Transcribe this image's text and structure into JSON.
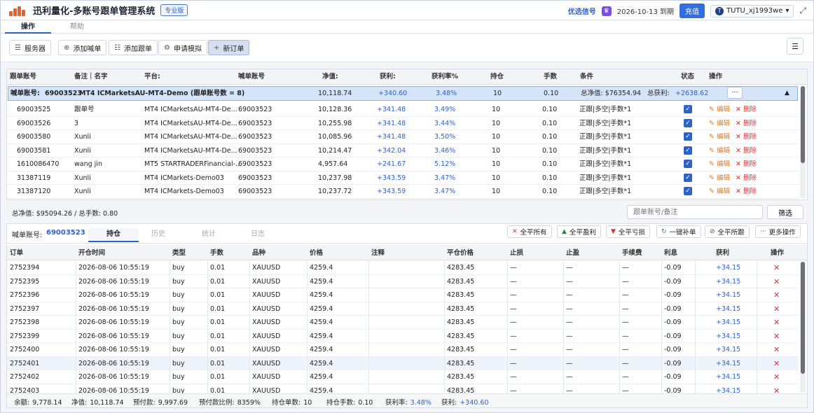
{
  "app": {
    "title": "迅利量化-多账号跟单管理系统",
    "edition": "专业版",
    "signal_link": "优选信号",
    "expire": "2026-10-13 到期",
    "recharge": "充值",
    "user": "TUTU_xj1993we",
    "user_initial": "T"
  },
  "top_tabs": [
    "操作",
    "帮助"
  ],
  "toolbar": {
    "server": "服务器",
    "add_signal": "添加喊单",
    "add_follow": "添加跟单",
    "apply_demo": "申请模拟",
    "new_order": "新订单"
  },
  "upper_table": {
    "headers": [
      "跟单账号",
      "备注｜名字",
      "平台:",
      "喊单账号",
      "净值:",
      "获利:",
      "获利率%",
      "持仓",
      "手数",
      "条件",
      "状态",
      "操作"
    ],
    "group": {
      "label": "喊单账号:",
      "account": "69003523",
      "platform": "MT4 ICMarketsAU-MT4-Demo (跟单账号数 = 8)",
      "equity": "10,118.74",
      "profit": "+340.60",
      "rate": "3.48%",
      "positions": "10",
      "lots": "0.10",
      "total_equity": "总净值:  $76354.94",
      "total_profit_label": "总获利:",
      "total_profit": "+2638.62",
      "more": "···",
      "sort": "▲"
    },
    "rows": [
      {
        "acct": "69003525",
        "note": "跟单号",
        "platform": "MT4 ICMarketsAU-MT4-De...",
        "signal": "69003523",
        "equity": "10,128.36",
        "profit": "+341.48",
        "rate": "3.49%",
        "pos": "10",
        "lots": "0.10",
        "cond": "正跟|多空|手数*1"
      },
      {
        "acct": "69003526",
        "note": "3",
        "platform": "MT4 ICMarketsAU-MT4-De...",
        "signal": "69003523",
        "equity": "10,255.98",
        "profit": "+341.48",
        "rate": "3.44%",
        "pos": "10",
        "lots": "0.10",
        "cond": "正跟|多空|手数*1"
      },
      {
        "acct": "69003580",
        "note": "Xunli",
        "platform": "MT4 ICMarketsAU-MT4-De...",
        "signal": "69003523",
        "equity": "10,085.96",
        "profit": "+341.48",
        "rate": "3.50%",
        "pos": "10",
        "lots": "0.10",
        "cond": "正跟|多空|手数*1"
      },
      {
        "acct": "69003581",
        "note": "Xunli",
        "platform": "MT4 ICMarketsAU-MT4-De...",
        "signal": "69003523",
        "equity": "10,214.47",
        "profit": "+342.04",
        "rate": "3.46%",
        "pos": "10",
        "lots": "0.10",
        "cond": "正跟|多空|手数*1"
      },
      {
        "acct": "1610086470",
        "note": "wang jin",
        "platform": "MT5 STARTRADERFinancial-...",
        "signal": "69003523",
        "equity": "4,957.64",
        "profit": "+241.67",
        "rate": "5.12%",
        "pos": "10",
        "lots": "0.10",
        "cond": "正跟|多空|手数*1"
      },
      {
        "acct": "31387119",
        "note": "Xunli",
        "platform": "MT4 ICMarkets-Demo03",
        "signal": "69003523",
        "equity": "10,237.98",
        "profit": "+343.59",
        "rate": "3.47%",
        "pos": "10",
        "lots": "0.10",
        "cond": "正跟|多空|手数*1"
      },
      {
        "acct": "31387120",
        "note": "Xunli",
        "platform": "MT4 ICMarkets-Demo03",
        "signal": "69003523",
        "equity": "10,237.72",
        "profit": "+343.59",
        "rate": "3.47%",
        "pos": "10",
        "lots": "0.10",
        "cond": "正跟|多空|手数*1"
      }
    ],
    "edit_label": "编辑",
    "delete_label": "删除"
  },
  "summary": {
    "text": "总净值: $95094.26 / 总手数: 0.80",
    "filter_placeholder": "跟单账号/备注",
    "filter_button": "筛选"
  },
  "lower": {
    "account_label": "喊单账号:",
    "account": "69003523",
    "tabs": [
      "持仓",
      "历史",
      "统计",
      "日志"
    ],
    "actions": [
      {
        "icon": "✕",
        "label": "全平所有",
        "color": "#d9333a"
      },
      {
        "icon": "▲",
        "label": "全平盈利",
        "color": "#2e8b3a"
      },
      {
        "icon": "▼",
        "label": "全平亏损",
        "color": "#d9333a"
      },
      {
        "icon": "↻",
        "label": "一键补单",
        "color": "#2e8b3a"
      },
      {
        "icon": "⊘",
        "label": "全平所跟",
        "color": "#555555"
      },
      {
        "icon": "···",
        "label": "更多操作",
        "color": "#555555"
      }
    ],
    "headers": [
      "订单",
      "开仓时间",
      "类型",
      "手数",
      "品种",
      "价格",
      "注释",
      "平仓价格",
      "止损",
      "止盈",
      "手续费",
      "利息",
      "获利",
      "操作"
    ],
    "orders": [
      {
        "id": "2752394",
        "time": "2026-08-06 10:55:19",
        "type": "buy",
        "lots": "0.01",
        "symbol": "XAUUSD",
        "price": "4259.4",
        "comment": "",
        "close": "4283.45",
        "sl": "—",
        "tp": "—",
        "fee": "—",
        "swap": "-0.09",
        "profit": "+34.15"
      },
      {
        "id": "2752395",
        "time": "2026-08-06 10:55:19",
        "type": "buy",
        "lots": "0.01",
        "symbol": "XAUUSD",
        "price": "4259.4",
        "comment": "",
        "close": "4283.45",
        "sl": "—",
        "tp": "—",
        "fee": "—",
        "swap": "-0.09",
        "profit": "+34.15"
      },
      {
        "id": "2752396",
        "time": "2026-08-06 10:55:19",
        "type": "buy",
        "lots": "0.01",
        "symbol": "XAUUSD",
        "price": "4259.4",
        "comment": "",
        "close": "4283.45",
        "sl": "—",
        "tp": "—",
        "fee": "—",
        "swap": "-0.09",
        "profit": "+34.15"
      },
      {
        "id": "2752397",
        "time": "2026-08-06 10:55:19",
        "type": "buy",
        "lots": "0.01",
        "symbol": "XAUUSD",
        "price": "4259.4",
        "comment": "",
        "close": "4283.45",
        "sl": "—",
        "tp": "—",
        "fee": "—",
        "swap": "-0.09",
        "profit": "+34.15"
      },
      {
        "id": "2752398",
        "time": "2026-08-06 10:55:19",
        "type": "buy",
        "lots": "0.01",
        "symbol": "XAUUSD",
        "price": "4259.4",
        "comment": "",
        "close": "4283.45",
        "sl": "—",
        "tp": "—",
        "fee": "—",
        "swap": "-0.09",
        "profit": "+34.15"
      },
      {
        "id": "2752399",
        "time": "2026-08-06 10:55:19",
        "type": "buy",
        "lots": "0.01",
        "symbol": "XAUUSD",
        "price": "4259.4",
        "comment": "",
        "close": "4283.45",
        "sl": "—",
        "tp": "—",
        "fee": "—",
        "swap": "-0.09",
        "profit": "+34.15"
      },
      {
        "id": "2752400",
        "time": "2026-08-06 10:55:19",
        "type": "buy",
        "lots": "0.01",
        "symbol": "XAUUSD",
        "price": "4259.4",
        "comment": "",
        "close": "4283.45",
        "sl": "—",
        "tp": "—",
        "fee": "—",
        "swap": "-0.09",
        "profit": "+34.15"
      },
      {
        "id": "2752401",
        "time": "2026-08-06 10:55:19",
        "type": "buy",
        "lots": "0.01",
        "symbol": "XAUUSD",
        "price": "4259.4",
        "comment": "",
        "close": "4283.45",
        "sl": "—",
        "tp": "—",
        "fee": "—",
        "swap": "-0.09",
        "profit": "+34.15"
      },
      {
        "id": "2752402",
        "time": "2026-08-06 10:55:19",
        "type": "buy",
        "lots": "0.01",
        "symbol": "XAUUSD",
        "price": "4259.4",
        "comment": "",
        "close": "4283.45",
        "sl": "—",
        "tp": "—",
        "fee": "—",
        "swap": "-0.09",
        "profit": "+34.15"
      },
      {
        "id": "2752403",
        "time": "2026-08-06 10:55:19",
        "type": "buy",
        "lots": "0.01",
        "symbol": "XAUUSD",
        "price": "4259.4",
        "comment": "",
        "close": "4283.45",
        "sl": "—",
        "tp": "—",
        "fee": "—",
        "swap": "-0.09",
        "profit": "+34.15"
      }
    ],
    "footer": [
      {
        "label": "余额:",
        "value": "9,778.14"
      },
      {
        "label": "净值:",
        "value": "10,118.74"
      },
      {
        "label": "预付款:",
        "value": "9,997.69"
      },
      {
        "label": "预付款比例:",
        "value": "8359%"
      },
      {
        "label": "持仓单数:",
        "value": "10"
      },
      {
        "label": "持仓手数:",
        "value": "0.10"
      },
      {
        "label": "获利率:",
        "value": "3.48%"
      },
      {
        "label": "获利:",
        "value": "+340.60"
      }
    ]
  },
  "colors": {
    "accent": "#2f62c6",
    "profit": "#2f62c6",
    "delete": "#d9333a",
    "edit": "#e07a1f",
    "selected_group": "#d6e4fa"
  }
}
